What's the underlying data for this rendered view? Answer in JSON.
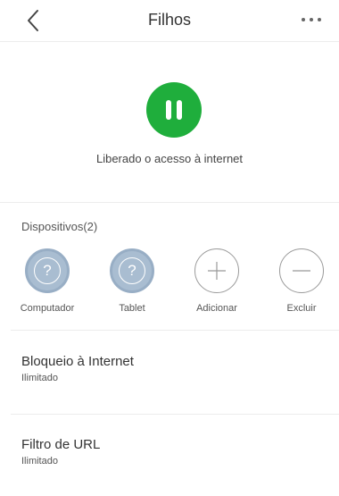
{
  "header": {
    "title": "Filhos",
    "back_icon": "chevron-left-icon",
    "more_icon": "more-dots-icon"
  },
  "status": {
    "text": "Liberado o acesso à internet",
    "color": "#1fae3c",
    "icon": "pause-icon"
  },
  "devices": {
    "title": "Dispositivos(2)",
    "items": [
      {
        "label": "Computador",
        "icon": "unknown-device-icon"
      },
      {
        "label": "Tablet",
        "icon": "unknown-device-icon"
      },
      {
        "label": "Adicionar",
        "icon": "plus-icon"
      },
      {
        "label": "Excluir",
        "icon": "minus-icon"
      }
    ]
  },
  "settings": [
    {
      "title": "Bloqueio à Internet",
      "value": "Ilimitado"
    },
    {
      "title": "Filtro de URL",
      "value": "Ilimitado"
    }
  ]
}
